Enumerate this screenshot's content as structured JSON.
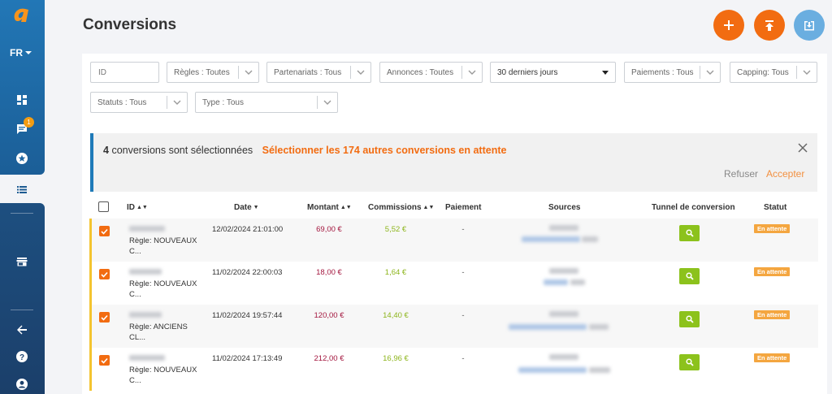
{
  "sidebar": {
    "language": "FR",
    "notification_count": "1",
    "icons": [
      "dashboard-icon",
      "messages-icon",
      "star-badge-icon",
      "list-icon",
      "store-icon",
      "back-arrow-icon",
      "help-icon",
      "user-icon"
    ]
  },
  "header": {
    "title": "Conversions",
    "actions": [
      "add-icon",
      "upload-icon",
      "download-icon"
    ]
  },
  "filters": {
    "id_placeholder": "ID",
    "regles": "Règles : Toutes",
    "partenariats": "Partenariats : Tous",
    "annonces": "Annonces : Toutes",
    "period": "30 derniers jours",
    "paiements": "Paiements : Tous",
    "capping": "Capping: Tous",
    "statuts": "Statuts : Tous",
    "type": "Type : Tous"
  },
  "selection_notice": {
    "count": "4",
    "text": "conversions sont sélectionnées",
    "select_all": "Sélectionner les 174 autres conversions en attente",
    "refuse": "Refuser",
    "accept": "Accepter"
  },
  "table": {
    "columns": {
      "id": "ID",
      "date": "Date",
      "amount": "Montant",
      "commissions": "Commissions",
      "payment": "Paiement",
      "sources": "Sources",
      "tunnel": "Tunnel de conversion",
      "status": "Statut"
    },
    "rows": [
      {
        "rule_line1": "Règle: NOUVEAUX",
        "rule_line2": "C...",
        "date": "12/02/2024 21:01:00",
        "amount": "69,00 €",
        "commission": "5,52 €",
        "payment": "-",
        "status": "En attente"
      },
      {
        "rule_line1": "Règle: NOUVEAUX",
        "rule_line2": "C...",
        "date": "11/02/2024 22:00:03",
        "amount": "18,00 €",
        "commission": "1,64 €",
        "payment": "-",
        "status": "En attente"
      },
      {
        "rule_line1": "Règle: ANCIENS",
        "rule_line2": "CL...",
        "date": "11/02/2024 19:57:44",
        "amount": "120,00 €",
        "commission": "14,40 €",
        "payment": "-",
        "status": "En attente"
      },
      {
        "rule_line1": "Règle: NOUVEAUX",
        "rule_line2": "C...",
        "date": "11/02/2024 17:13:49",
        "amount": "212,00 €",
        "commission": "16,96 €",
        "payment": "-",
        "status": "En attente"
      }
    ]
  },
  "colors": {
    "accent_orange": "#f26c11",
    "sidebar_blue": "#2277b6",
    "amount_red": "#a3163e",
    "commission_green": "#8db51c",
    "status_orange": "#f4a640"
  }
}
